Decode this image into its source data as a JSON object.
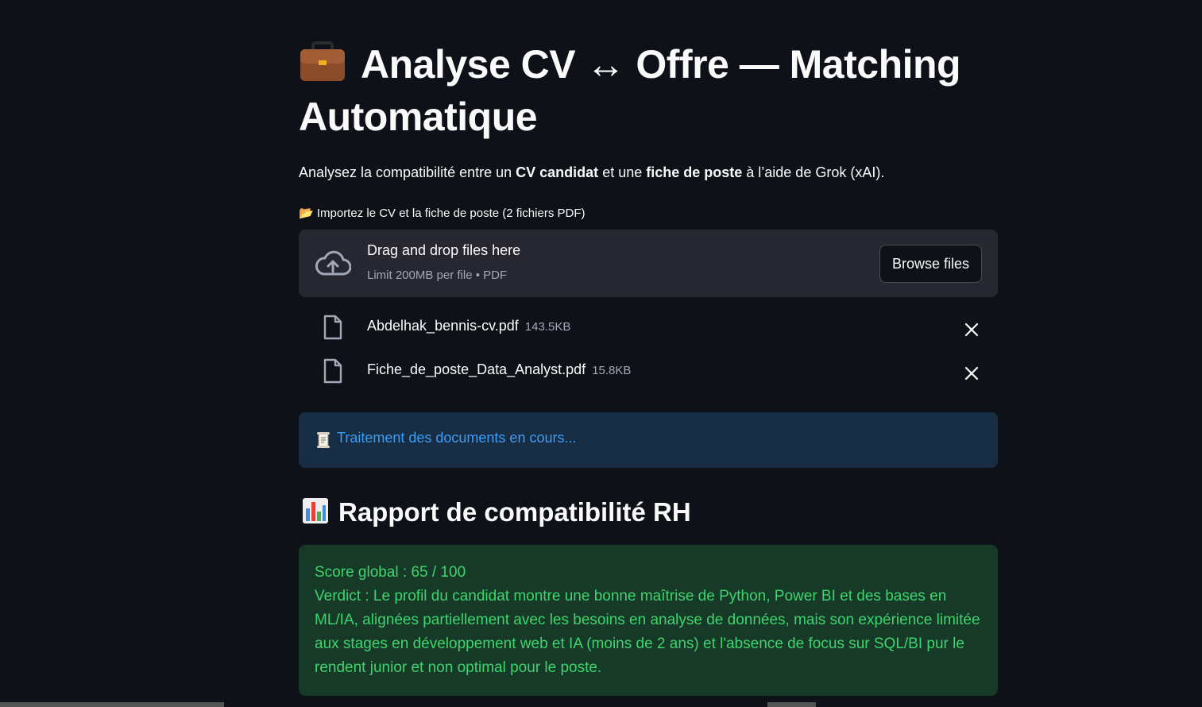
{
  "header": {
    "title_icon": "briefcase-icon",
    "title": "Analyse CV ↔ Offre — Matching Automatique"
  },
  "intro": {
    "part1": "Analysez la compatibilité entre un ",
    "bold1": "CV candidat",
    "part2": " et une ",
    "bold2": "fiche de poste",
    "part3": " à l’aide de Grok (xAI)."
  },
  "uploader": {
    "label": "📂 Importez le CV et la fiche de poste (2 fichiers PDF)",
    "drop_text": "Drag and drop files here",
    "limit_text": "Limit 200MB per file • PDF",
    "browse_label": "Browse files",
    "files": [
      {
        "name": "Abdelhak_bennis-cv.pdf",
        "size": "143.5KB"
      },
      {
        "name": "Fiche_de_poste_Data_Analyst.pdf",
        "size": "15.8KB"
      }
    ]
  },
  "info": {
    "icon": "scroll-icon",
    "text": "Traitement des documents en cours..."
  },
  "report": {
    "icon": "bar-chart-icon",
    "title": "Rapport de compatibilité RH",
    "score_line": "Score global : 65 / 100",
    "verdict": "Verdict : Le profil du candidat montre une bonne maîtrise de Python, Power BI et des bases en ML/IA, alignées partiellement avec les besoins en analyse de données, mais son expérience limitée aux stages en développement web et IA (moins de 2 ans) et l'absence de focus sur SQL/BI pur le rendent junior et non optimal pour le poste."
  },
  "colors": {
    "background": "#0e1117",
    "secondary_bg": "#262730",
    "info_bg": "#172d43",
    "info_text": "#3d9df3",
    "success_bg": "#173928",
    "success_text": "#3dd56d"
  }
}
